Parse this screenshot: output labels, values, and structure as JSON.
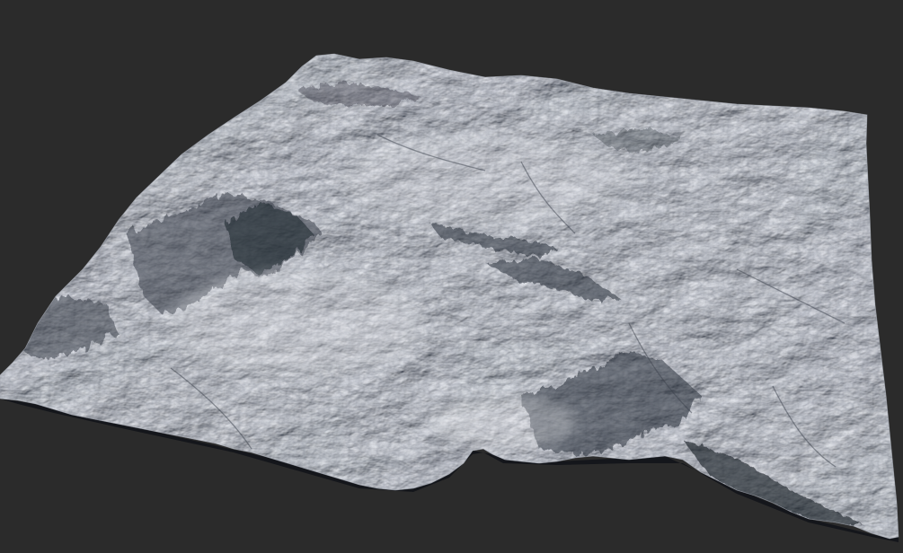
{
  "scene": {
    "background_color": "#2b2b2b",
    "subject": "terrain-heightmap-render",
    "surface_color": "#c9ccd2",
    "shadow_color": "#2a2f3a",
    "highlight_color": "#eef0f3"
  }
}
